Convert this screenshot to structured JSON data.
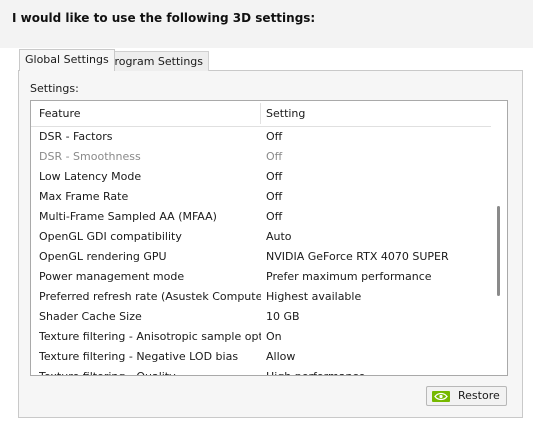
{
  "heading": "I would like to use the following 3D settings:",
  "tabs": [
    {
      "label": "Global Settings",
      "active": true
    },
    {
      "label": "Program Settings",
      "active": false
    }
  ],
  "settings_label": "Settings:",
  "columns": {
    "feature": "Feature",
    "setting": "Setting"
  },
  "rows": [
    {
      "feature": "DSR - Factors",
      "setting": "Off",
      "disabled": false
    },
    {
      "feature": "DSR - Smoothness",
      "setting": "Off",
      "disabled": true
    },
    {
      "feature": "Low Latency Mode",
      "setting": "Off",
      "disabled": false
    },
    {
      "feature": "Max Frame Rate",
      "setting": "Off",
      "disabled": false
    },
    {
      "feature": "Multi-Frame Sampled AA (MFAA)",
      "setting": "Off",
      "disabled": false
    },
    {
      "feature": "OpenGL GDI compatibility",
      "setting": "Auto",
      "disabled": false
    },
    {
      "feature": "OpenGL rendering GPU",
      "setting": "NVIDIA GeForce RTX 4070 SUPER",
      "disabled": false
    },
    {
      "feature": "Power management mode",
      "setting": "Prefer maximum performance",
      "disabled": false
    },
    {
      "feature": "Preferred refresh rate (Asustek Computer...",
      "setting": "Highest available",
      "disabled": false
    },
    {
      "feature": "Shader Cache Size",
      "setting": "10 GB",
      "disabled": false
    },
    {
      "feature": "Texture filtering - Anisotropic sample opti...",
      "setting": "On",
      "disabled": false
    },
    {
      "feature": "Texture filtering - Negative LOD bias",
      "setting": "Allow",
      "disabled": false
    },
    {
      "feature": "Texture filtering - Quality",
      "setting": "High performance",
      "disabled": false
    }
  ],
  "restore_label": "Restore",
  "icons": {
    "restore": "nvidia-logo-icon"
  },
  "colors": {
    "nvidia_green": "#76b900"
  }
}
